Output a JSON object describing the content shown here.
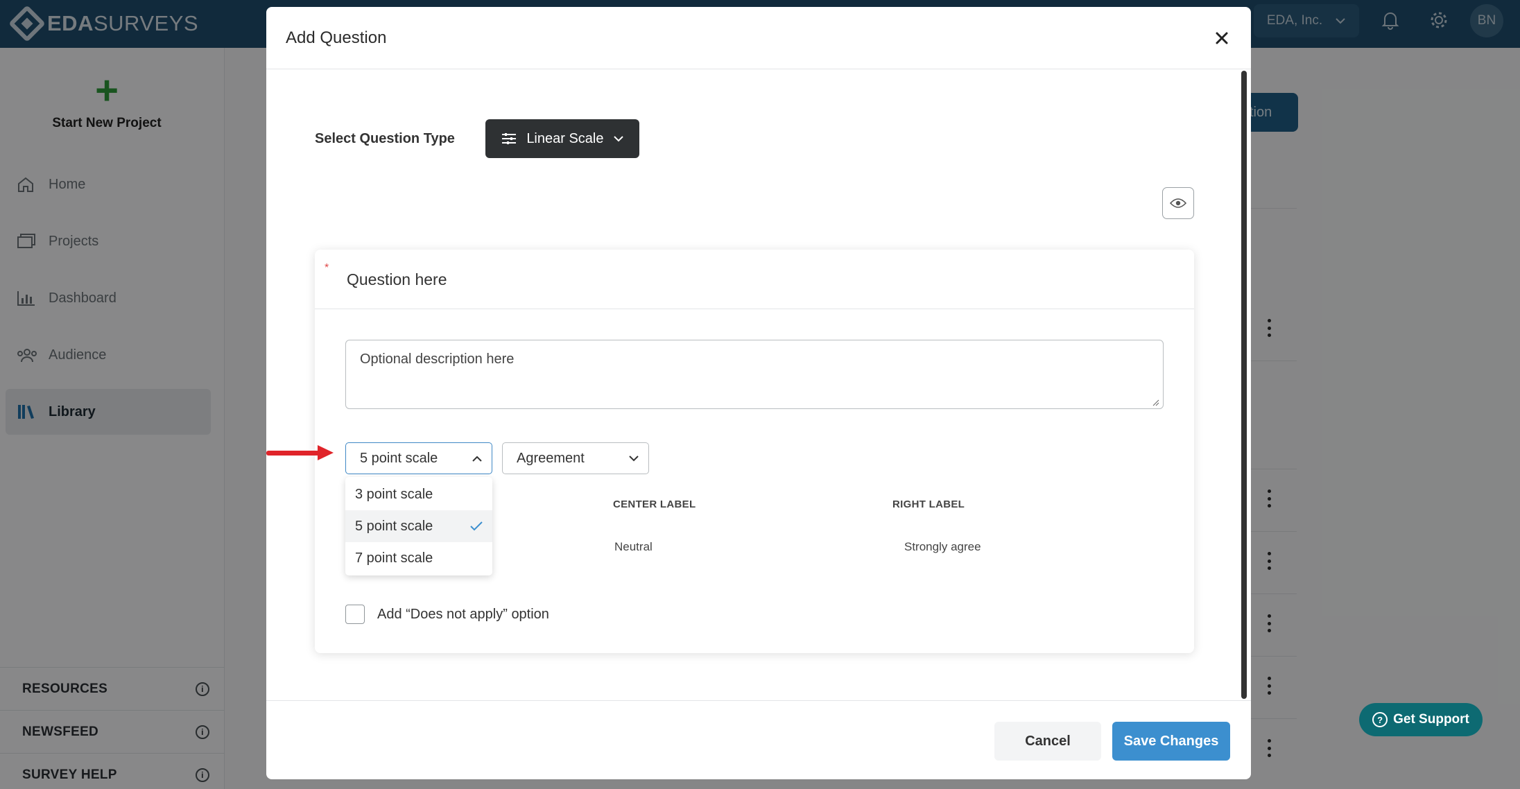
{
  "app": {
    "logo_bold": "EDA",
    "logo_light": "SURVEYS",
    "org_name": "EDA, Inc.",
    "avatar_initials": "BN"
  },
  "sidebar": {
    "new_project_label": "Start New Project",
    "items": [
      {
        "label": "Home",
        "icon": "home-icon"
      },
      {
        "label": "Projects",
        "icon": "folders-icon"
      },
      {
        "label": "Dashboard",
        "icon": "bar-chart-icon"
      },
      {
        "label": "Audience",
        "icon": "people-icon"
      },
      {
        "label": "Library",
        "icon": "library-icon",
        "active": true
      }
    ],
    "sections": [
      {
        "label": "RESOURCES"
      },
      {
        "label": "NEWSFEED"
      },
      {
        "label": "SURVEY HELP"
      }
    ]
  },
  "background": {
    "add_question_partial": "stion"
  },
  "support": {
    "label": "Get Support"
  },
  "modal": {
    "title": "Add Question",
    "question_type_label": "Select Question Type",
    "question_type_value": "Linear Scale",
    "question_placeholder": "Question here",
    "description_placeholder": "Optional description here",
    "scale": {
      "selected": "5 point scale",
      "options": [
        {
          "label": "3 point scale"
        },
        {
          "label": "5 point scale",
          "selected": true
        },
        {
          "label": "7 point scale"
        }
      ]
    },
    "label_set": "Agreement",
    "columns": {
      "center_label": "CENTER LABEL",
      "right_label": "RIGHT LABEL",
      "center_value": "Neutral",
      "right_value": "Strongly agree"
    },
    "does_not_apply_label": "Add “Does not apply” option",
    "does_not_apply_checked": false,
    "cancel_label": "Cancel",
    "save_label": "Save Changes"
  },
  "colors": {
    "topbar": "#1f4e6e",
    "primary": "#3c8fcf",
    "support": "#0d6a72",
    "annotation_arrow": "#e0242a"
  }
}
